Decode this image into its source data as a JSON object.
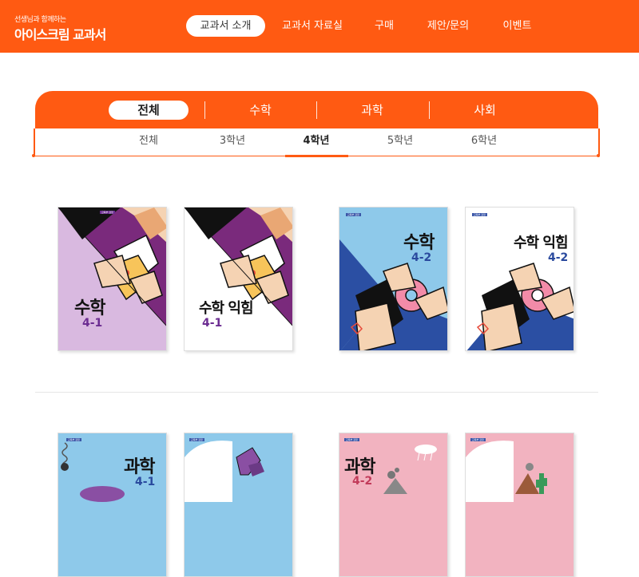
{
  "header": {
    "logo_small": "선생님과 함께하는",
    "logo_main": "아이스크림 교과서",
    "nav": [
      "교과서 소개",
      "교과서 자료실",
      "구매",
      "제안/문의",
      "이벤트"
    ]
  },
  "subjects": [
    "전체",
    "수학",
    "과학",
    "사회"
  ],
  "grades": [
    "전체",
    "3학년",
    "4학년",
    "5학년",
    "6학년"
  ],
  "books": [
    {
      "title": "수학",
      "number": "4-1",
      "bg": "#d9b9e0",
      "num_color": "#6b2c91"
    },
    {
      "title": "수학 익힘",
      "number": "4-1",
      "bg": "#ffffff",
      "num_color": "#6b2c91"
    },
    {
      "title": "수학",
      "number": "4-2",
      "bg": "#8ec9ea",
      "num_color": "#2a4a9e"
    },
    {
      "title": "수학 익힘",
      "number": "4-2",
      "bg": "#ffffff",
      "num_color": "#2a4a9e"
    },
    {
      "title": "과학",
      "number": "4-1",
      "bg": "#8ec9ea",
      "num_color": "#2a4a9e"
    },
    {
      "title": "",
      "number": "",
      "bg": "#8ec9ea",
      "num_color": "#2a4a9e"
    },
    {
      "title": "과학",
      "number": "4-2",
      "bg": "#f2b3c0",
      "num_color": "#c23b5a"
    },
    {
      "title": "",
      "number": "",
      "bg": "#f2b3c0",
      "num_color": "#c23b5a"
    }
  ],
  "colors": {
    "accent": "#ff5a12"
  }
}
